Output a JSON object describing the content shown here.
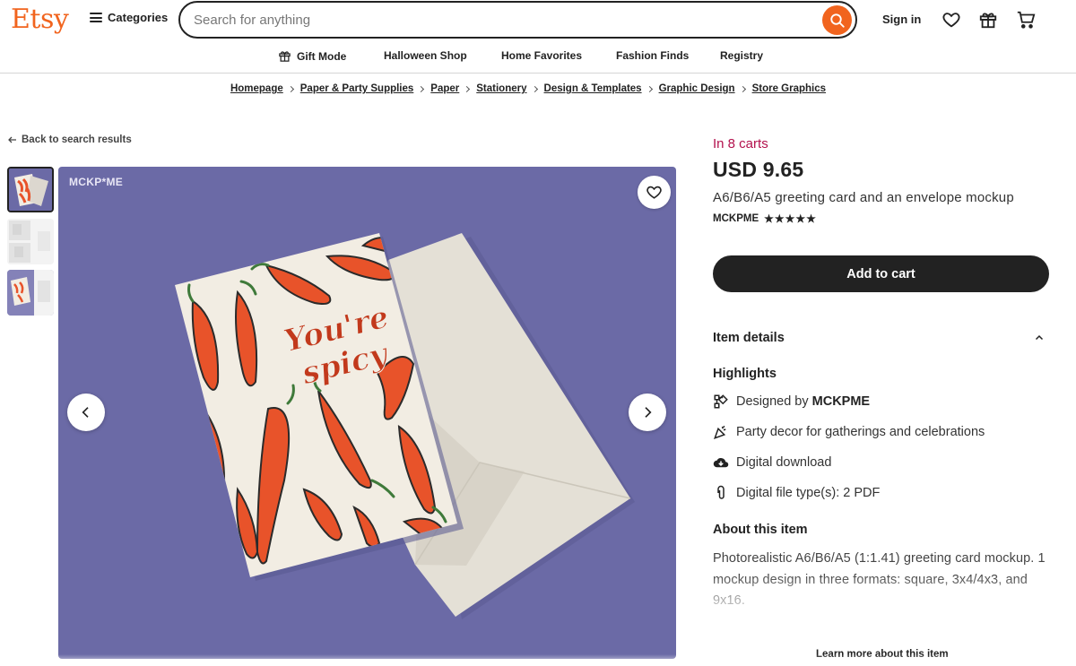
{
  "header": {
    "logo": "Etsy",
    "categories_label": "Categories",
    "search_placeholder": "Search for anything",
    "signin_label": "Sign in"
  },
  "nav": {
    "items": [
      {
        "label": "Gift Mode",
        "icon": "gift-icon"
      },
      {
        "label": "Halloween Shop"
      },
      {
        "label": "Home Favorites"
      },
      {
        "label": "Fashion Finds"
      },
      {
        "label": "Registry"
      }
    ]
  },
  "breadcrumb": [
    "Homepage",
    "Paper & Party Supplies",
    "Paper",
    "Stationery",
    "Design & Templates",
    "Graphic Design",
    "Store Graphics"
  ],
  "back_label": "Back to search results",
  "gallery": {
    "watermark": "MCKP*ME",
    "card_text_1": "You're",
    "card_text_2": "spicy"
  },
  "product": {
    "in_carts": "In 8 carts",
    "price": "USD 9.65",
    "title": "A6/B6/A5 greeting card and an envelope mockup",
    "shop": "MCKPME",
    "rating_stars": "★★★★★",
    "add_to_cart": "Add to cart",
    "item_details": "Item details",
    "highlights_title": "Highlights",
    "highlights": [
      {
        "icon": "designer-icon",
        "prefix": "Designed by ",
        "bold": "MCKPME"
      },
      {
        "icon": "party-icon",
        "text": "Party decor for gatherings and celebrations"
      },
      {
        "icon": "download-icon",
        "text": "Digital download"
      },
      {
        "icon": "paperclip-icon",
        "text": "Digital file type(s): 2 PDF"
      }
    ],
    "about_title": "About this item",
    "description": "Photorealistic A6/B6/A5 (1:1.41) greeting card mockup. 1 mockup design in three formats: square, 3x4/4x3, and 9x16.",
    "learn_more": "Learn more about this item"
  },
  "colors": {
    "brand": "#f1641e",
    "in_carts": "#b3114d",
    "image_bg": "#6b6aa6"
  }
}
